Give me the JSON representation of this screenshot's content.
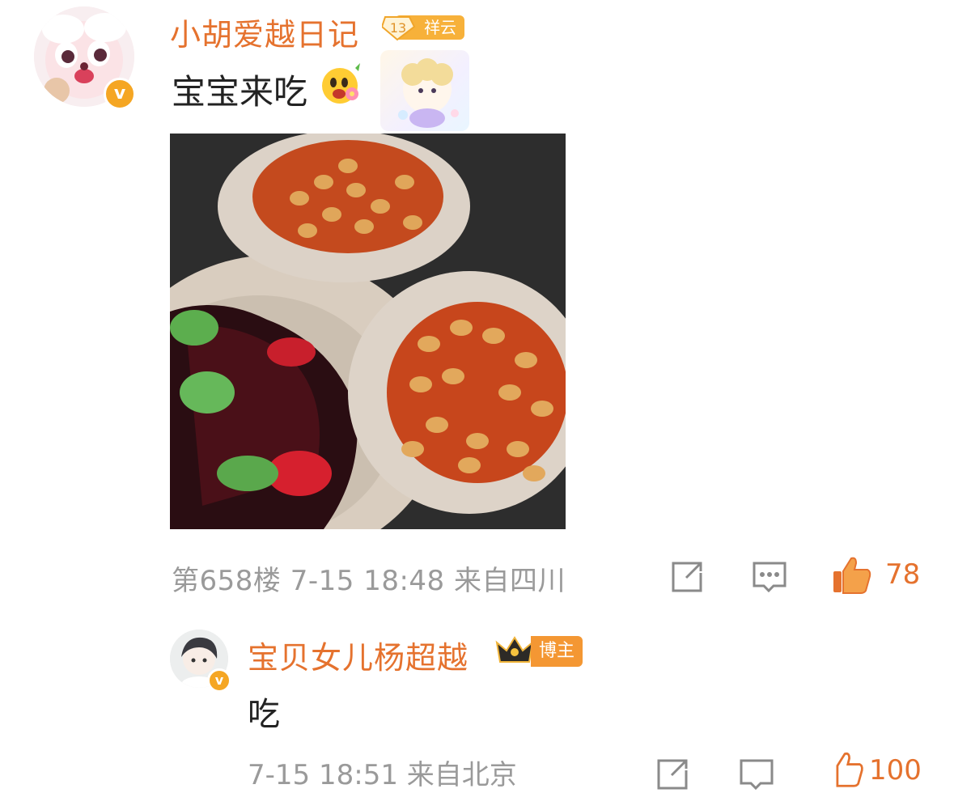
{
  "comment": {
    "username": "小胡爱越日记",
    "level_badge": {
      "level": "13",
      "label": "祥云"
    },
    "verified_badge": "v",
    "text": "宝宝来吃",
    "floor": "第658楼",
    "time": "7-15 18:48",
    "location": "来自四川",
    "like_count": "78",
    "icons": {
      "share": "share-icon",
      "comment": "comment-icon",
      "like": "thumb-up-icon"
    }
  },
  "reply": {
    "username": "宝贝女儿杨超越",
    "role_badge": "博主",
    "verified_badge": "v",
    "text": "吃",
    "time": "7-15 18:51",
    "location": "来自北京",
    "like_count": "100"
  },
  "colors": {
    "accent": "#e5722e",
    "meta": "#9a9a9a",
    "text": "#222222",
    "badge": "#f5a623"
  }
}
